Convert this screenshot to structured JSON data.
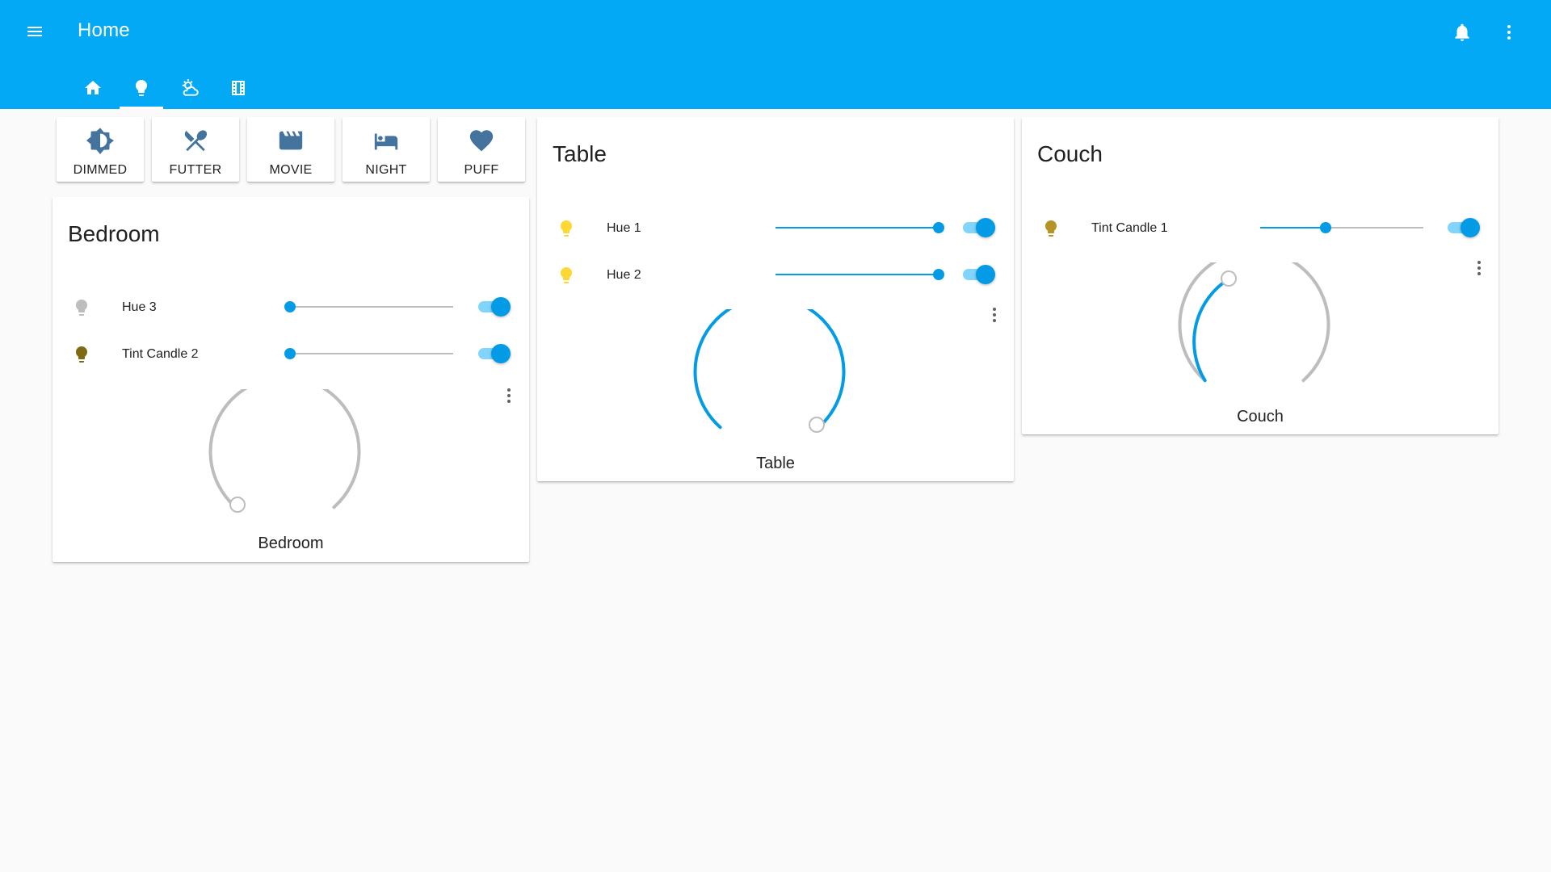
{
  "header": {
    "title": "Home",
    "tabs": [
      {
        "icon": "home-icon",
        "active": false
      },
      {
        "icon": "lightbulb-icon",
        "active": true
      },
      {
        "icon": "weather-icon",
        "active": false
      },
      {
        "icon": "film-icon",
        "active": false
      }
    ]
  },
  "scenes": [
    {
      "label": "DIMMED",
      "icon": "brightness-icon"
    },
    {
      "label": "FUTTER",
      "icon": "silverware-icon"
    },
    {
      "label": "MOVIE",
      "icon": "clapperboard-icon"
    },
    {
      "label": "NIGHT",
      "icon": "bed-icon"
    },
    {
      "label": "PUFF",
      "icon": "heart-icon"
    }
  ],
  "colors": {
    "accent": "#03a9f4",
    "slider": "#039be5",
    "bulb_off": "#bdbdbd",
    "bulb_dim": "#7f6a14",
    "bulb_mid": "#b59324",
    "bulb_bright": "#fdd835",
    "scene_icon": "#44739e"
  },
  "cards": {
    "bedroom": {
      "title": "Bedroom",
      "lights": [
        {
          "name": "Hue 3",
          "brightness": 0,
          "on": true,
          "bulb_color": "#bdbdbd"
        },
        {
          "name": "Tint Candle 2",
          "brightness": 0,
          "on": true,
          "bulb_color": "#7f6a14"
        }
      ],
      "gauge": {
        "label": "Bedroom",
        "level": 0.0,
        "bulb_color": "#7f6a14"
      }
    },
    "table": {
      "title": "Table",
      "lights": [
        {
          "name": "Hue 1",
          "brightness": 100,
          "on": true,
          "bulb_color": "#fdd835"
        },
        {
          "name": "Hue 2",
          "brightness": 100,
          "on": true,
          "bulb_color": "#fdd835"
        }
      ],
      "gauge": {
        "label": "Table",
        "level": 1.0,
        "bulb_color": "#fdd835"
      }
    },
    "couch": {
      "title": "Couch",
      "lights": [
        {
          "name": "Tint Candle 1",
          "brightness": 40,
          "on": true,
          "bulb_color": "#b59324"
        }
      ],
      "gauge": {
        "label": "Couch",
        "level": 0.4,
        "bulb_color": "#b59324"
      }
    }
  }
}
